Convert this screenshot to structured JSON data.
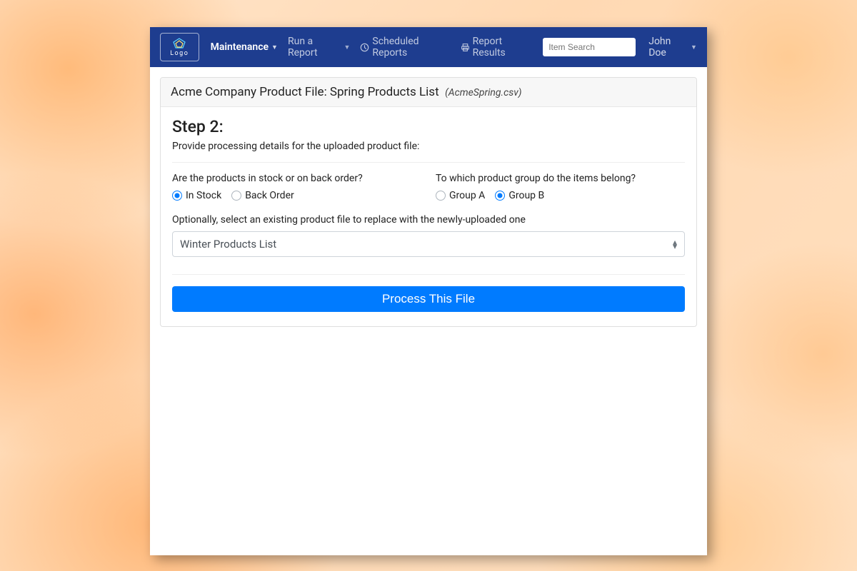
{
  "navbar": {
    "logo_text": "Logo",
    "items": [
      {
        "label": "Maintenance",
        "active": true,
        "has_caret": true
      },
      {
        "label": "Run a Report",
        "active": false,
        "has_caret": true
      },
      {
        "label": "Scheduled Reports",
        "active": false,
        "icon": "clock"
      },
      {
        "label": "Report Results",
        "active": false,
        "icon": "print"
      }
    ],
    "search_placeholder": "Item Search",
    "user_name": "John Doe"
  },
  "card": {
    "header_title": "Acme Company Product File: Spring Products List",
    "header_filename": "(AcmeSpring.csv)",
    "step_title": "Step 2:",
    "step_desc": "Provide processing details for the uploaded product file:",
    "stock_question": "Are the products in stock or on back order?",
    "stock_options": [
      {
        "label": "In Stock",
        "checked": true
      },
      {
        "label": "Back Order",
        "checked": false
      }
    ],
    "group_question": "To which product group do the items belong?",
    "group_options": [
      {
        "label": "Group A",
        "checked": false
      },
      {
        "label": "Group B",
        "checked": true
      }
    ],
    "replace_label": "Optionally, select an existing product file to replace with the newly-uploaded one",
    "replace_selected": "Winter Products List",
    "process_button": "Process This File"
  }
}
